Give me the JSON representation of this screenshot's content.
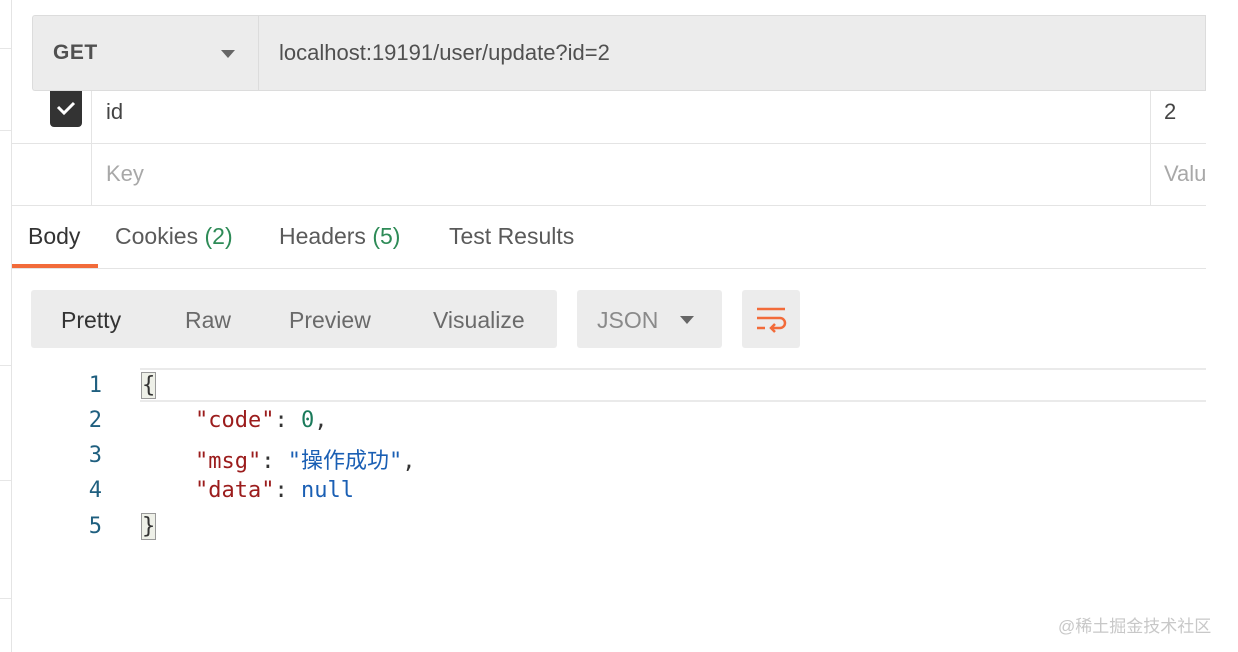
{
  "request": {
    "method": "GET",
    "url": "localhost:19191/user/update?id=2"
  },
  "params": {
    "rows": [
      {
        "key": "id",
        "value": "2",
        "checked": true
      }
    ],
    "key_placeholder": "Key",
    "value_placeholder": "Valu"
  },
  "response_tabs": {
    "body": "Body",
    "cookies": "Cookies",
    "cookies_count": "(2)",
    "headers": "Headers",
    "headers_count": "(5)",
    "test_results": "Test Results"
  },
  "view_modes": {
    "pretty": "Pretty",
    "raw": "Raw",
    "preview": "Preview",
    "visualize": "Visualize",
    "format": "JSON"
  },
  "code": {
    "line_numbers": [
      "1",
      "2",
      "3",
      "4",
      "5"
    ],
    "open_brace": "{",
    "close_brace": "}",
    "lines": [
      {
        "key": "\"code\"",
        "value": "0"
      },
      {
        "key": "\"msg\"",
        "value": "\"操作成功\""
      },
      {
        "key": "\"data\"",
        "value": "null"
      }
    ]
  },
  "colors": {
    "accent": "#f26b3a",
    "count_green": "#2e8b57",
    "json_key": "#9b1c1c",
    "json_string": "#1a5fb4"
  },
  "watermark": "@稀土掘金技术社区"
}
